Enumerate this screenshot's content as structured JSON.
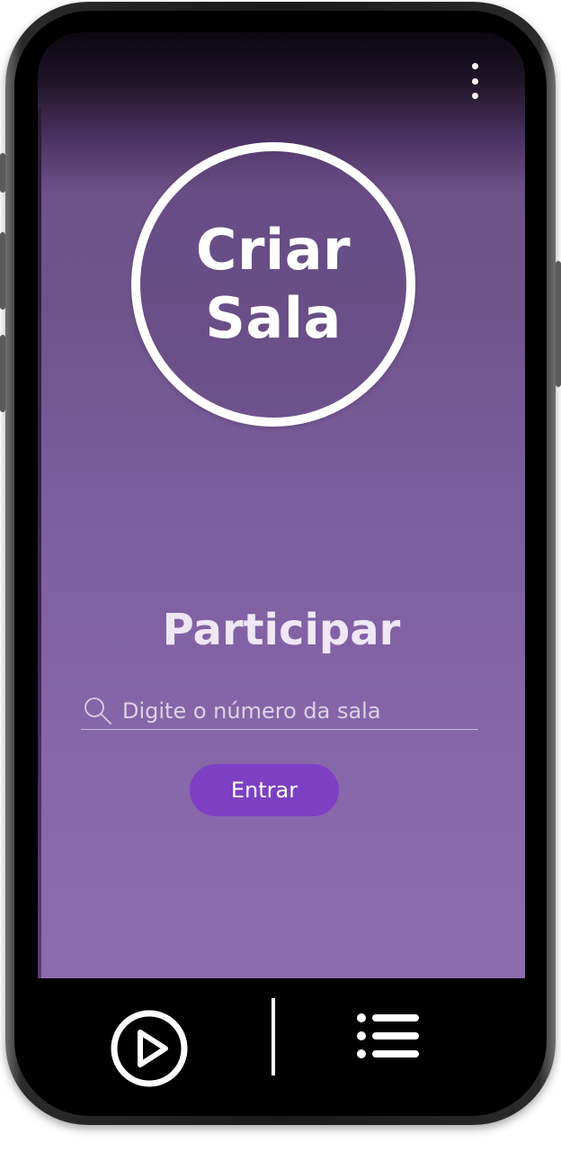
{
  "app": {
    "accent_color": "#7d3fc4",
    "background_color": "#7b5e9e"
  },
  "header": {
    "menu_icon": "more-vertical-icon"
  },
  "create_room": {
    "label": "Criar Sala"
  },
  "join": {
    "title": "Participar",
    "search_icon": "search-icon",
    "search_placeholder": "Digite o número da sala",
    "search_value": "",
    "enter_button_label": "Entrar"
  },
  "bottom_nav": {
    "items": [
      {
        "icon": "play-circle-icon"
      },
      {
        "icon": "list-icon"
      }
    ]
  }
}
